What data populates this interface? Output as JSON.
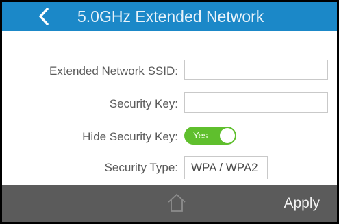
{
  "header": {
    "title": "5.0GHz Extended Network",
    "back_icon": "chevron-left-icon"
  },
  "form": {
    "ssid_label": "Extended Network SSID:",
    "ssid_value": "",
    "key_label": "Security Key:",
    "key_value": "",
    "hide_label": "Hide Security Key:",
    "hide_toggle": "Yes",
    "hide_enabled": true,
    "type_label": "Security Type:",
    "type_value": "WPA / WPA2"
  },
  "footer": {
    "home_icon": "home-icon",
    "apply_label": "Apply"
  },
  "colors": {
    "header": "#1b88c8",
    "toggle_on": "#5fbf2d",
    "footer": "#5b5b5b"
  }
}
